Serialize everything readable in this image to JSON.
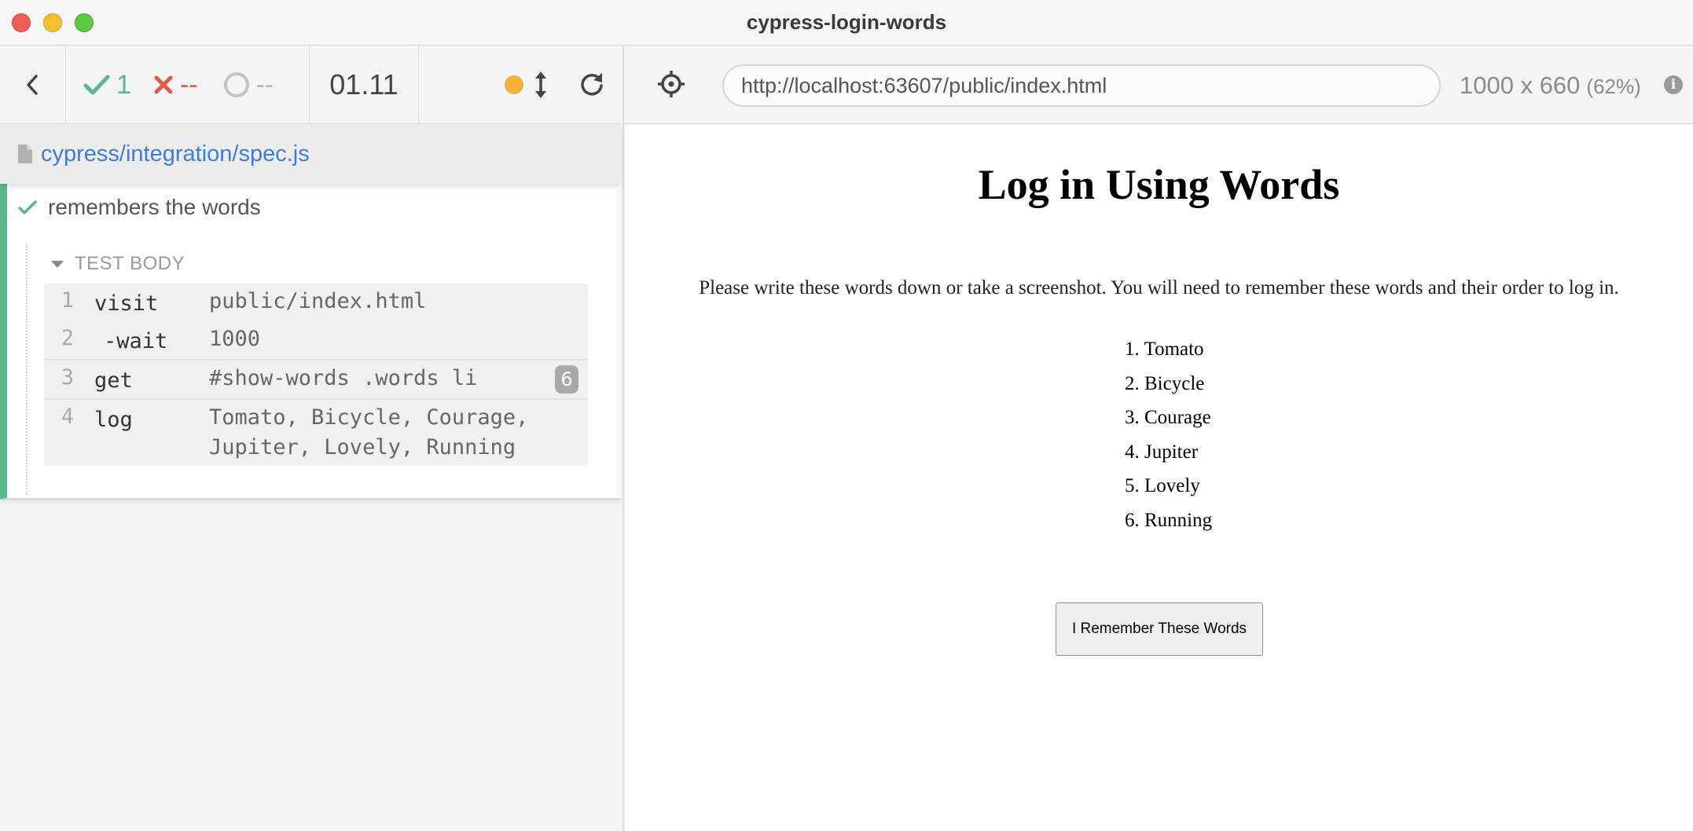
{
  "window": {
    "title": "cypress-login-words"
  },
  "reporter": {
    "stats": {
      "passed": "1",
      "failed": "--",
      "pending": "--"
    },
    "duration": "01.11",
    "spec_file": "cypress/integration/spec.js",
    "test": {
      "title": "remembers the words",
      "status": "passed",
      "section_label": "TEST BODY",
      "commands": [
        {
          "number": "1",
          "name": "visit",
          "message": "public/index.html",
          "badge": ""
        },
        {
          "number": "2",
          "name": "-wait",
          "message": "1000",
          "badge": ""
        },
        {
          "number": "3",
          "name": "get",
          "message": "#show-words .words li",
          "badge": "6"
        },
        {
          "number": "4",
          "name": "log",
          "message": "Tomato, Bicycle, Courage, Jupiter, Lovely, Running",
          "badge": ""
        }
      ]
    }
  },
  "aut_header": {
    "url": "http://localhost:63607/public/index.html",
    "viewport": "1000 x 660",
    "scale": "(62%)"
  },
  "aut_page": {
    "heading": "Log in Using Words",
    "instructions": "Please write these words down or take a screenshot. You will need to remember these words and their order to log in.",
    "words": [
      "1. Tomato",
      "2. Bicycle",
      "3. Courage",
      "4. Jupiter",
      "5. Lovely",
      "6. Running"
    ],
    "button_label": "I Remember These Words"
  },
  "icons": {
    "back": "chevron-left-icon",
    "passed": "check-icon",
    "failed": "x-icon",
    "pending": "spinner-circle-icon",
    "running": "yellow-dot-icon",
    "autoscroll": "vertical-arrows-icon",
    "restart": "reload-icon",
    "selector": "crosshair-icon",
    "file": "file-icon",
    "info": "info-icon"
  },
  "colors": {
    "pass": "#5ab98b",
    "fail": "#df5c4c",
    "link": "#3f7bd9",
    "running": "#f3b13c"
  }
}
